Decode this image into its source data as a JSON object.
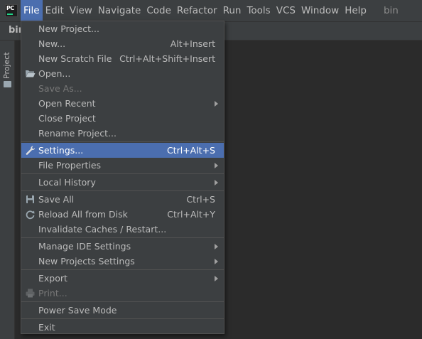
{
  "menubar": {
    "items": [
      "File",
      "Edit",
      "View",
      "Navigate",
      "Code",
      "Refactor",
      "Run",
      "Tools",
      "VCS",
      "Window",
      "Help"
    ],
    "project": "bin"
  },
  "navbar": {
    "label": "bin"
  },
  "sidebar": {
    "tab": "Project"
  },
  "file_menu": {
    "new_project": "New Project...",
    "new": "New...",
    "new_sc": "Alt+Insert",
    "new_scratch": "New Scratch File",
    "new_scratch_sc": "Ctrl+Alt+Shift+Insert",
    "open": "Open...",
    "save_as": "Save As...",
    "open_recent": "Open Recent",
    "close_project": "Close Project",
    "rename_project": "Rename Project...",
    "settings": "Settings...",
    "settings_sc": "Ctrl+Alt+S",
    "file_properties": "File Properties",
    "local_history": "Local History",
    "save_all": "Save All",
    "save_all_sc": "Ctrl+S",
    "reload": "Reload All from Disk",
    "reload_sc": "Ctrl+Alt+Y",
    "invalidate": "Invalidate Caches / Restart...",
    "manage_ide": "Manage IDE Settings",
    "new_projects_settings": "New Projects Settings",
    "export": "Export",
    "print": "Print...",
    "power_save": "Power Save Mode",
    "exit": "Exit"
  },
  "colors": {
    "highlight": "#4b6eaf",
    "background": "#3c3f41",
    "editor": "#2b2b2b"
  }
}
